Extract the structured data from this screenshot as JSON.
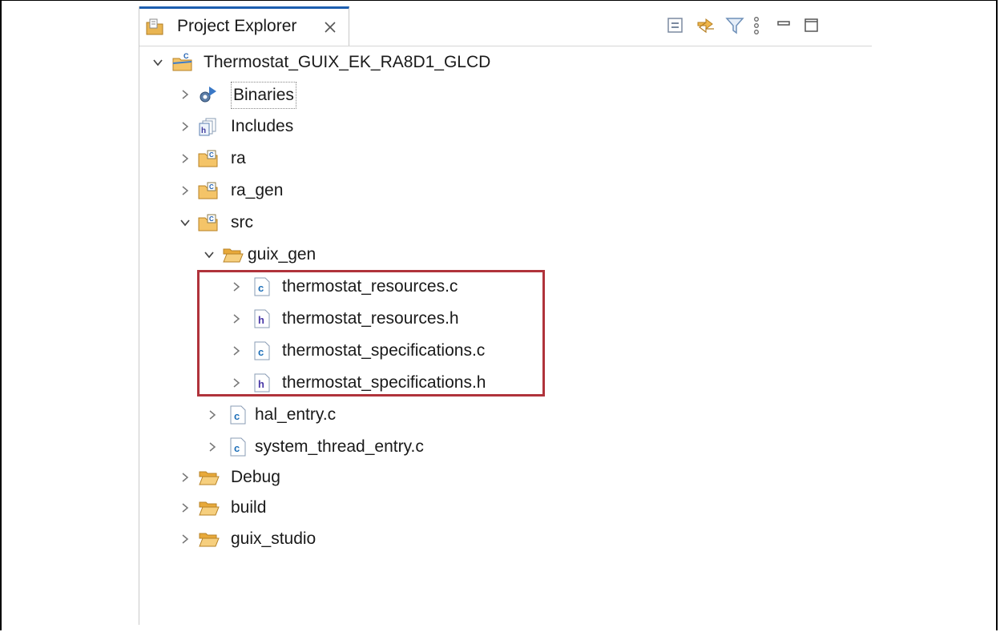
{
  "panel": {
    "tab_label": "Project Explorer"
  },
  "tree": {
    "project": "Thermostat_GUIX_EK_RA8D1_GLCD",
    "binaries": "Binaries",
    "includes": "Includes",
    "ra": "ra",
    "ra_gen": "ra_gen",
    "src": "src",
    "guix_gen": "guix_gen",
    "guix_files": [
      "thermostat_resources.c",
      "thermostat_resources.h",
      "thermostat_specifications.c",
      "thermostat_specifications.h"
    ],
    "hal_entry": "hal_entry.c",
    "system_thread_entry": "system_thread_entry.c",
    "debug": "Debug",
    "build": "build",
    "guix_studio": "guix_studio"
  },
  "colors": {
    "highlight_box": "#b0333b",
    "tab_accent": "#1e5fb0",
    "folder": "#e8b04a",
    "c_file": "#1d6fb8",
    "h_file": "#4a3aa8"
  },
  "icons": {
    "toolbar": [
      "collapse-all-icon",
      "link-with-editor-icon",
      "filter-icon",
      "view-menu-icon",
      "minimize-icon",
      "maximize-icon"
    ]
  }
}
